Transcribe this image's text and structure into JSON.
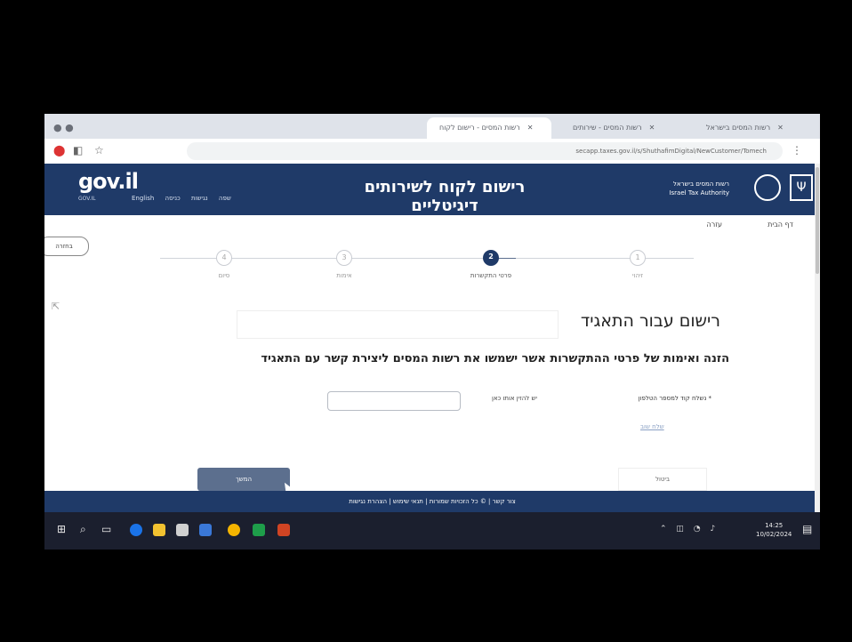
{
  "browser": {
    "tabs": [
      {
        "label": "רשות המסים - רישום לקוח"
      },
      {
        "label": "רשות המסים - שירותים"
      },
      {
        "label": "רשות המסים בישראל"
      }
    ],
    "url": "secapp.taxes.gov.il/s/ShuthafimDigital/NewCustomer/Tomech"
  },
  "header": {
    "logo": "gov.il",
    "logo_sub": "GOV.IL",
    "page_heading": "רישום לקוח לשירותים דיגיטליים",
    "authority_name_he": "רשות המסים בישראל",
    "authority_name_en": "Israel Tax Authority",
    "links": [
      "כניסה",
      "נגישות",
      "שפה",
      "English"
    ]
  },
  "breadcrumb": {
    "home": "דף הבית",
    "help": "עזרה"
  },
  "back_button": "בחזרה",
  "steps": [
    {
      "number": "1",
      "label": "זיהוי"
    },
    {
      "number": "2",
      "label": "פרטי התקשרות"
    },
    {
      "number": "3",
      "label": "אימות"
    },
    {
      "number": "4",
      "label": "סיום"
    }
  ],
  "form": {
    "title": "רישום עבור התאגיד",
    "subtitle": "הזנה ואימות של פרטי ההתקשרות אשר ישמשו את רשות המסים ליצירת קשר עם התאגיד",
    "code_label": "* נשלח קוד למספר הטלפון",
    "code_hint": "יש להזין אותו כאן",
    "code_value": "",
    "send_again": "שלח שוב",
    "continue": "המשך",
    "cancel": "ביטול"
  },
  "footer": {
    "text": "צור קשר | © כל הזכויות שמורות | תנאי שימוש | הצהרת נגישות"
  },
  "taskbar": {
    "time": "14:25",
    "date": "10/02/2024"
  },
  "colors": {
    "brand_navy": "#1f3a68",
    "button_slate": "#5c6f8e"
  }
}
